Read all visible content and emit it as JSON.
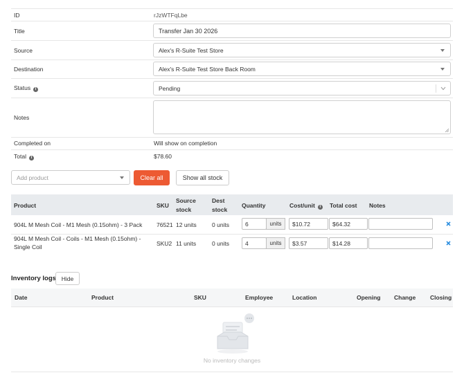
{
  "form": {
    "id_label": "ID",
    "id_value": "rJzWTFqLbe",
    "title_label": "Title",
    "title_value": "Transfer Jan 30 2026",
    "source_label": "Source",
    "source_value": "Alex's R-Suite Test Store",
    "destination_label": "Destination",
    "destination_value": "Alex's R-Suite Test Store Back Room",
    "status_label": "Status",
    "status_value": "Pending",
    "notes_label": "Notes",
    "notes_value": "",
    "completed_label": "Completed on",
    "completed_value": "Will show on completion",
    "total_label": "Total",
    "total_value": "$78.60"
  },
  "actions": {
    "add_product_placeholder": "Add product",
    "clear_all": "Clear all",
    "show_all_stock": "Show all stock"
  },
  "products_table": {
    "headers": {
      "product": "Product",
      "sku": "SKU",
      "source_stock_1": "Source",
      "source_stock_2": "stock",
      "dest_stock_1": "Dest",
      "dest_stock_2": "stock",
      "quantity": "Quantity",
      "cost_unit": "Cost/unit",
      "total_cost": "Total cost",
      "notes": "Notes"
    },
    "units_label": "units",
    "rows": [
      {
        "product_1": "904L M Mesh Coil - M1 Mesh (0.15ohm) - 3 Pack",
        "product_2": "",
        "sku": "76521",
        "source_stock": "12 units",
        "dest_stock": "0 units",
        "quantity": "6",
        "cost_unit": "$10.72",
        "total_cost": "$64.32",
        "notes": ""
      },
      {
        "product_1": "904L M Mesh Coil - Coils - M1 Mesh (0.15ohm) -",
        "product_2": "Single Coil",
        "sku": "SKU2",
        "source_stock": "11 units",
        "dest_stock": "0 units",
        "quantity": "4",
        "cost_unit": "$3.57",
        "total_cost": "$14.28",
        "notes": ""
      }
    ]
  },
  "inventory_logs": {
    "title": "Inventory logs",
    "hide_button": "Hide",
    "headers": {
      "date": "Date",
      "product": "Product",
      "sku": "SKU",
      "employee": "Employee",
      "location": "Location",
      "opening": "Opening",
      "change": "Change",
      "closing": "Closing"
    },
    "empty_text": "No inventory changes"
  },
  "colors": {
    "accent_red": "#ed5a33",
    "link_blue": "#2e8fe0",
    "header_bg": "#e8ebee"
  }
}
